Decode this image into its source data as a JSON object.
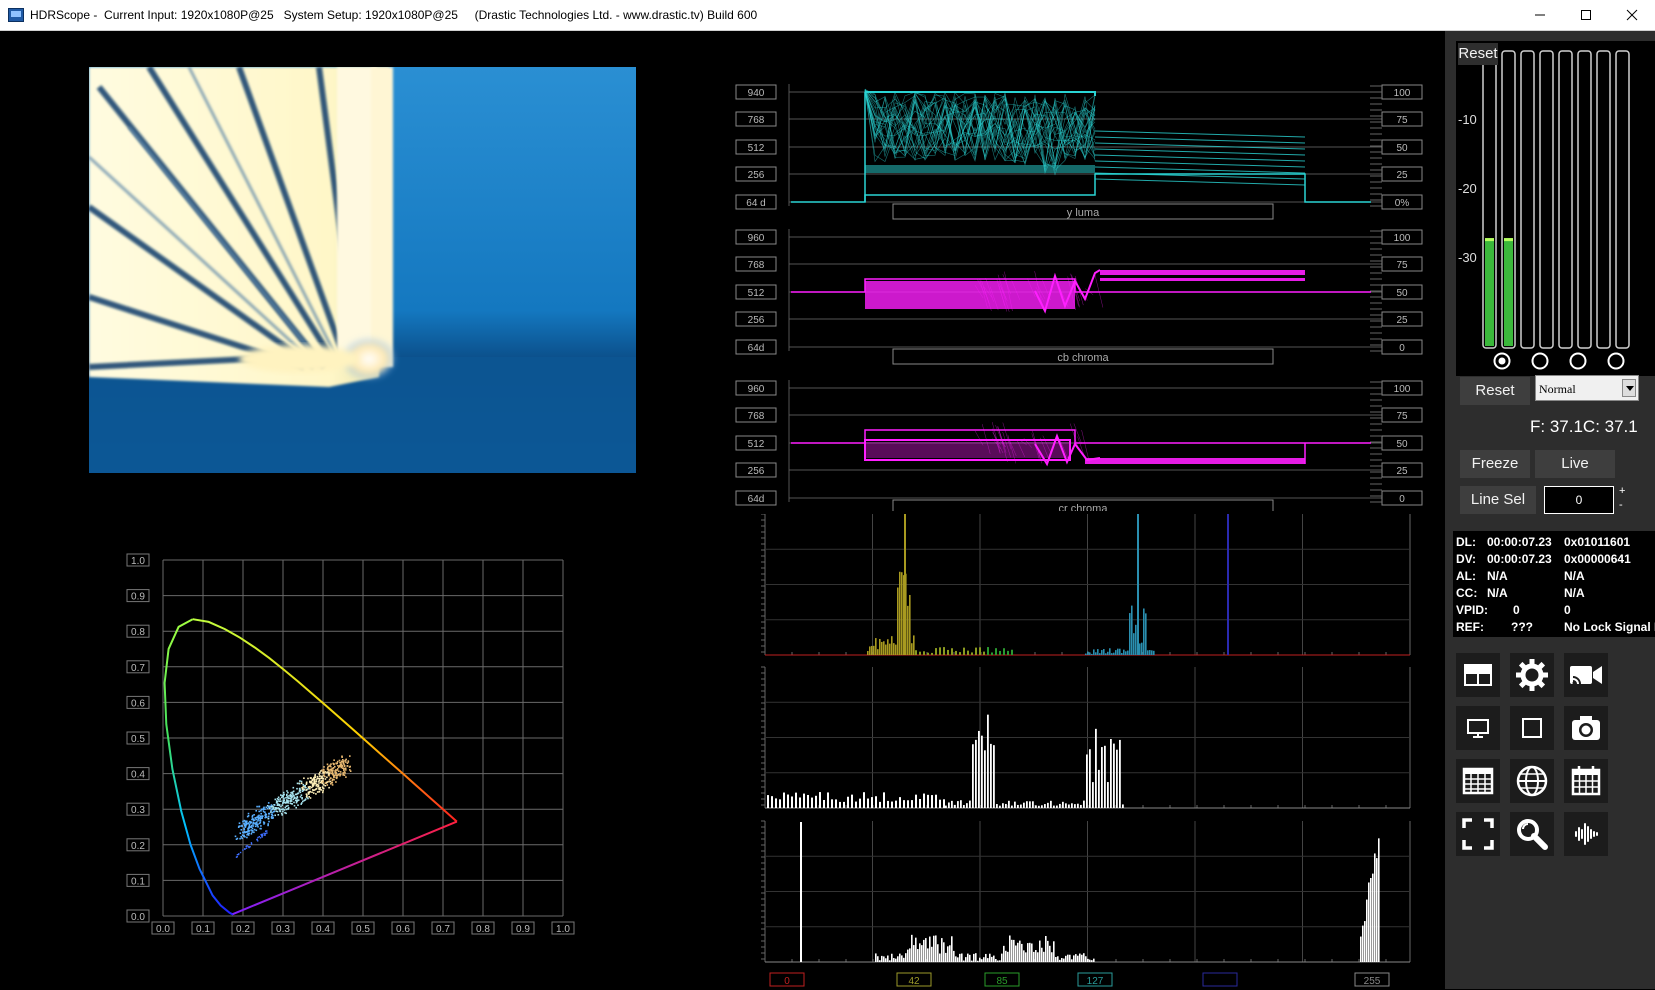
{
  "window": {
    "title": "HDRScope -  Current Input: 1920x1080P@25   System Setup: 1920x1080P@25     (Drastic Technologies Ltd. - www.drastic.tv) Build 600"
  },
  "waveforms": [
    {
      "name": "y luma",
      "left_ticks": [
        "940",
        "768",
        "512",
        "256",
        "64 d"
      ],
      "right_ticks": [
        "100",
        "75",
        "50",
        "25",
        "0%"
      ],
      "color": "#2ad4d4"
    },
    {
      "name": "cb chroma",
      "left_ticks": [
        "960",
        "768",
        "512",
        "256",
        "64d"
      ],
      "right_ticks": [
        "100",
        "75",
        "50",
        "25",
        "0"
      ],
      "color": "#ff1fff"
    },
    {
      "name": "cr chroma",
      "left_ticks": [
        "960",
        "768",
        "512",
        "256",
        "64d"
      ],
      "right_ticks": [
        "100",
        "75",
        "50",
        "25",
        "0"
      ],
      "color": "#ff1fff"
    }
  ],
  "histogram_scale": [
    "0",
    "42",
    "85",
    "127",
    "",
    "255"
  ],
  "histogram_scale_colors": [
    "#c02020",
    "#9c9a2a",
    "#2a9c2a",
    "#2a9c9a",
    "#2a2a9c",
    "#888888"
  ],
  "cie_chart": {
    "y_ticks": [
      "0.0",
      "0.1",
      "0.2",
      "0.3",
      "0.4",
      "0.5",
      "0.6",
      "0.7",
      "0.8",
      "0.9",
      "1.0"
    ],
    "x_ticks": [
      "0.0",
      "0.1",
      "0.2",
      "0.3",
      "0.4",
      "0.5",
      "0.6",
      "0.7",
      "0.8",
      "0.9",
      "1.0"
    ]
  },
  "audio": {
    "reset_label": "Reset",
    "db_marks": [
      "-10",
      "-20",
      "-30"
    ],
    "channel_count": 8,
    "levels": [
      0.37,
      0.37,
      0,
      0,
      0,
      0,
      0,
      0
    ]
  },
  "controls": {
    "reset_label": "Reset",
    "mode_value": "Normal",
    "fc_readout": "F: 37.1C: 37.1",
    "freeze_label": "Freeze",
    "live_label": "Live",
    "line_sel_label": "Line Sel",
    "line_value": "0",
    "spin_plus": "+",
    "spin_minus": "-"
  },
  "timecode": {
    "rows": [
      {
        "label": "DL:",
        "v1": "00:00:07.23",
        "v2": "0x01011601"
      },
      {
        "label": "DV:",
        "v1": "00:00:07.23",
        "v2": "0x00000641"
      },
      {
        "label": "AL:",
        "v1": "N/A",
        "v2": "N/A"
      },
      {
        "label": "CC:",
        "v1": "N/A",
        "v2": "N/A"
      },
      {
        "label": "VPID:",
        "v1": "0",
        "v2": "0"
      },
      {
        "label": "REF:",
        "v1": "???",
        "v2": "No Lock Signal Pr"
      }
    ]
  },
  "tool_icons": [
    "layout-icon",
    "settings-gear-icon",
    "cast-camera-icon",
    "monitor-icon",
    "square-icon",
    "camera-icon",
    "table-icon",
    "globe-icon",
    "calendar-icon",
    "fullscreen-icon",
    "search-icon",
    "audio-waveform-icon"
  ]
}
